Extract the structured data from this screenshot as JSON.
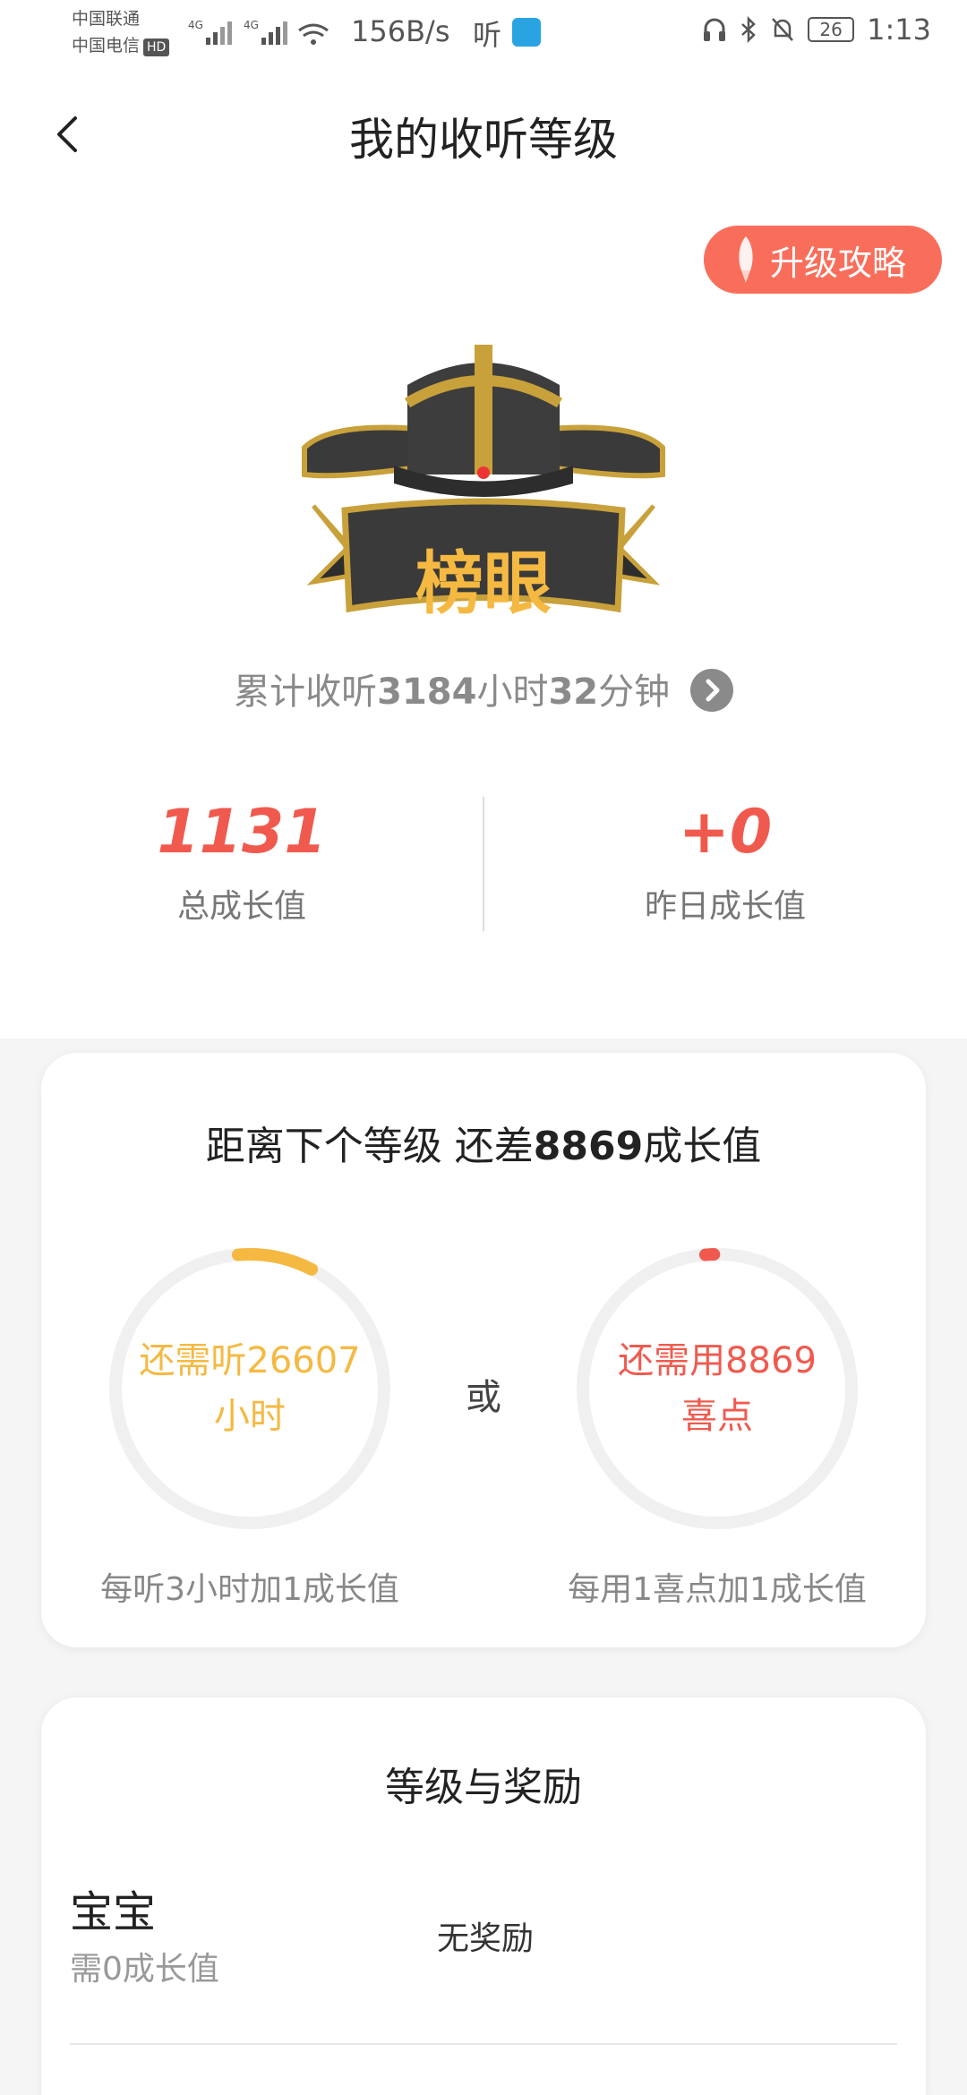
{
  "status_bar": {
    "carrier1": "中国联通",
    "carrier2": "中国电信",
    "hd": "HD",
    "signal1": "4G",
    "signal2": "4G",
    "speed": "156B/s",
    "app_text": "听",
    "battery": "26",
    "time": "1:13"
  },
  "nav": {
    "title": "我的收听等级"
  },
  "guide": {
    "label": "升级攻略"
  },
  "badge": {
    "level_name": "榜眼"
  },
  "listening": {
    "prefix": "累计收听",
    "hours": "3184",
    "hours_unit": "小时",
    "minutes": "32",
    "minutes_unit": "分钟"
  },
  "stats": {
    "total_value": "1131",
    "total_label": "总成长值",
    "yesterday_value": "+0",
    "yesterday_label": "昨日成长值"
  },
  "progress": {
    "title_prefix": "距离下个等级 还差",
    "remaining": "8869",
    "title_suffix": "成长值",
    "left_line1": "还需听26607",
    "left_line2": "小时",
    "left_note": "每听3小时加1成长值",
    "left_fraction": 0.09,
    "or": "或",
    "right_line1": "还需用8869",
    "right_line2": "喜点",
    "right_note": "每用1喜点加1成长值",
    "right_fraction": 0.01,
    "colors": {
      "left": "#f5b942",
      "right": "#f05a4e",
      "track": "#f0f0f0"
    }
  },
  "rewards": {
    "title": "等级与奖励",
    "items": [
      {
        "level": "宝宝",
        "need": "需0成长值",
        "reward": "无奖励"
      }
    ]
  }
}
